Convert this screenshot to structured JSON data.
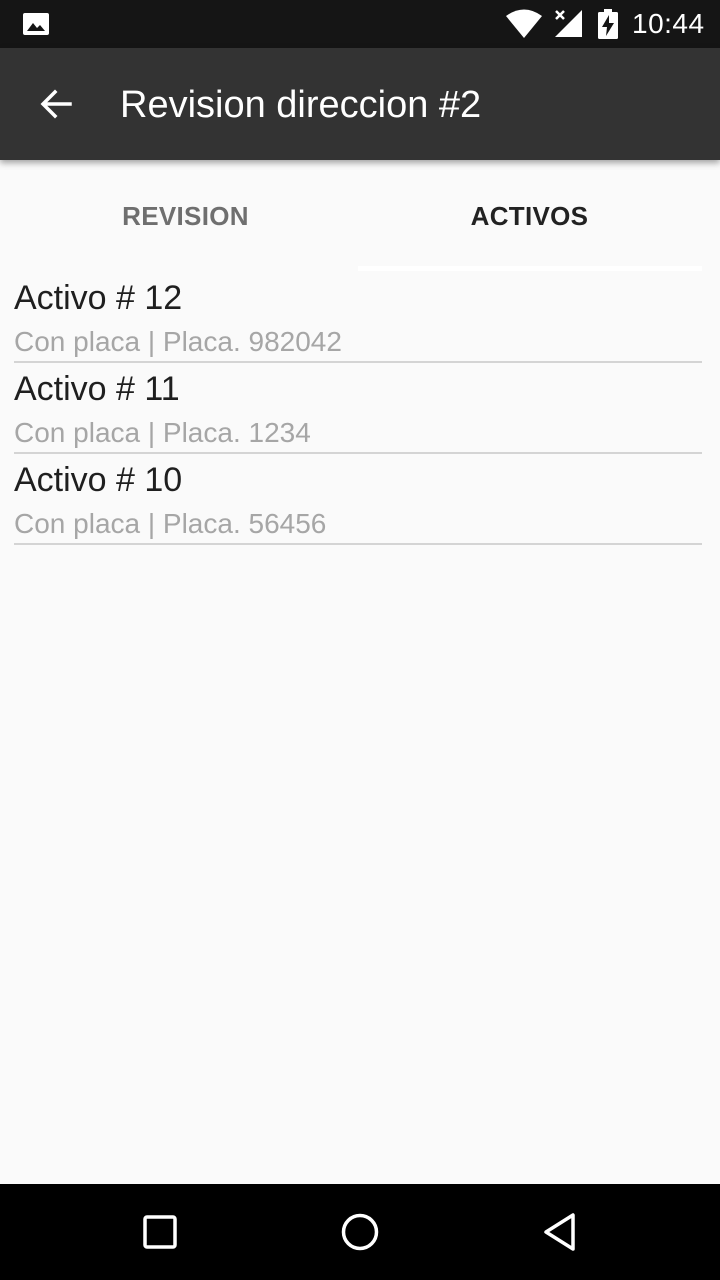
{
  "status_bar": {
    "time": "10:44",
    "icons": [
      "gallery-icon",
      "wifi-icon",
      "signal-icon",
      "battery-charging-icon"
    ]
  },
  "app_bar": {
    "title": "Revision direccion #2",
    "back_icon": "arrow-back-icon"
  },
  "tabs": [
    {
      "label": "REVISION",
      "selected": false
    },
    {
      "label": "ACTIVOS",
      "selected": true
    }
  ],
  "activos": [
    {
      "title": "Activo # 12",
      "subtitle": "Con placa | Placa. 982042"
    },
    {
      "title": "Activo # 11",
      "subtitle": "Con placa | Placa. 1234"
    },
    {
      "title": "Activo # 10",
      "subtitle": "Con placa | Placa. 56456"
    }
  ],
  "nav_bar": {
    "icons": [
      "recents-icon",
      "home-icon",
      "back-icon"
    ]
  },
  "colors": {
    "status_bar": "#151515",
    "app_bar": "#333333",
    "background": "#fafafa",
    "tab_selected_text": "#222222",
    "tab_unselected_text": "#6f6f6f",
    "subtitle_text": "#a6a6a6"
  }
}
